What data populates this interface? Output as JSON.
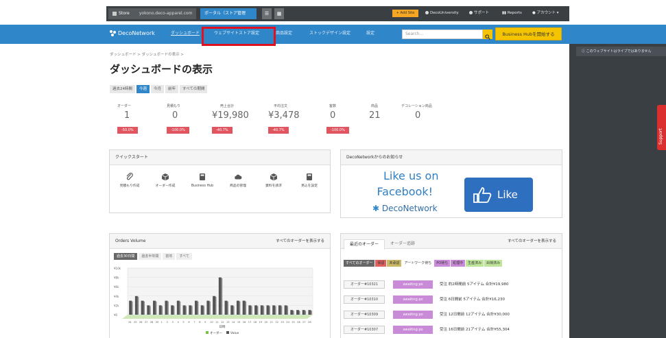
{
  "topbar": {
    "store_label": "Store",
    "store_url": "yokono.deco-apparel.com",
    "portal_label": "ポータル（ストア管理",
    "add_label": "+ Add Site",
    "links": [
      "DecoUniversity",
      "サポート",
      "Reports",
      "アカウント ▾"
    ]
  },
  "nav": {
    "logo": "DecoNetwork",
    "items": [
      "ダッシュボード",
      "ウェブサイトストア設定",
      "商品設定",
      "ストックデザイン設定",
      "設定"
    ],
    "search_placeholder": "Search...",
    "bizhub_label": "Business Hubを開始する"
  },
  "sidebar": {
    "notice": "このウェブサイトはライブではありません",
    "support_label": "Support"
  },
  "breadcrumb": "ダッシュボード > ダッシュボードの表示 >",
  "page_title": "ダッシュボードの表示",
  "period_tabs": [
    "過去24時間",
    "今週",
    "今月",
    "前年",
    "すべての期間"
  ],
  "stats": [
    {
      "label": "オーダー",
      "value": "1",
      "badge": "-50.0%"
    },
    {
      "label": "見積もり",
      "value": "0",
      "badge": "-100.0%"
    },
    {
      "label": "売上合計",
      "value": "¥19,980",
      "badge": "-40.7%"
    },
    {
      "label": "平均注文",
      "value": "¥3,478",
      "badge": "-40.7%"
    },
    {
      "label": "客数",
      "value": "0",
      "badge": "-100.0%"
    },
    {
      "label": "商品",
      "value": "21",
      "badge": ""
    },
    {
      "label": "デコレーション商品",
      "value": "0",
      "badge": ""
    }
  ],
  "quickstart": {
    "title": "クイックスタート",
    "items": [
      "見積もり作成",
      "オーダー作成",
      "Business Hub",
      "商品の管理",
      "資料を請求",
      "見込を設定"
    ]
  },
  "news": {
    "title": "DecoNetworkからのお知らせ",
    "fb_line1": "Like us on",
    "fb_line2": "Facebook!",
    "brand": "DecoNetwork",
    "like": "Like"
  },
  "orders_volume": {
    "title": "Orders Volume",
    "view_all": "すべてのオーダーを表示する",
    "tabs": [
      "過去30日間",
      "過去半年間",
      "前年",
      "すべて"
    ],
    "legend": [
      "オーダー",
      "Value"
    ],
    "x_title": "日時",
    "x_ticks": [
      "24",
      "25",
      "26",
      "27",
      "28",
      "29",
      "1",
      "2",
      "3",
      "4",
      "5",
      "6",
      "7",
      "8",
      "9",
      "10",
      "11",
      "12",
      "13",
      "14",
      "15",
      "16",
      "17",
      "18",
      "19",
      "20",
      "21",
      "22",
      "23",
      "24",
      "25",
      "26",
      "27",
      "28"
    ],
    "y_ticks": [
      "¥10k",
      "¥8k",
      "¥6k",
      "¥4k",
      "¥2k",
      "¥0"
    ]
  },
  "chart_data": {
    "type": "bar",
    "xlabel": "日時",
    "ylabel": "",
    "categories": [
      "24",
      "25",
      "26",
      "27",
      "28",
      "29",
      "30",
      "31",
      "1",
      "2",
      "3",
      "4",
      "5",
      "6",
      "7",
      "8",
      "9",
      "10",
      "11",
      "12",
      "13",
      "14",
      "15",
      "16",
      "17",
      "18",
      "19",
      "20",
      "21",
      "22",
      "23"
    ],
    "series": [
      {
        "name": "オーダー",
        "values": [
          3,
          4,
          3,
          2,
          3,
          2,
          3,
          2,
          3,
          2,
          2,
          3,
          2,
          3,
          4,
          8,
          3,
          2,
          3,
          3,
          2,
          2,
          2,
          2,
          2,
          2,
          2,
          1,
          1,
          1,
          1
        ]
      }
    ],
    "ylim": [
      0,
      10
    ],
    "grid": true
  },
  "recent_orders": {
    "tabs": [
      "最近のオーダー",
      "オーダー追跡"
    ],
    "view_all": "すべてのオーダーを表示する",
    "statuses": [
      {
        "label": "すべてのオーダー",
        "color": "#666666"
      },
      {
        "label": "保留",
        "color": "#e06060"
      },
      {
        "label": "未承認",
        "color": "#c9b866"
      },
      {
        "label": "アートワーク待ち",
        "color": "#ffffff"
      },
      {
        "label": "PO待ち",
        "color": "#c98ad8"
      },
      {
        "label": "処理中",
        "color": "#c98ad8"
      },
      {
        "label": "生産済み",
        "color": "#bfe59a"
      },
      {
        "label": "出荷済み",
        "color": "#bfe59a"
      }
    ],
    "rows": [
      {
        "id": "オーダー#10321",
        "status": "awaiting po",
        "detail": "受注 約2時間前 5アイテム 合計¥19,980"
      },
      {
        "id": "オーダー#10310",
        "status": "awaiting po",
        "detail": "受注 6日間前 5アイテム 合計¥16,230"
      },
      {
        "id": "オーダー#10309",
        "status": "awaiting po",
        "detail": "受注 12日間前 12アイテム 合計¥30,000"
      },
      {
        "id": "オーダー#10307",
        "status": "awaiting po",
        "detail": "受注 16日間前 21アイテム 合計¥55,304"
      }
    ]
  }
}
